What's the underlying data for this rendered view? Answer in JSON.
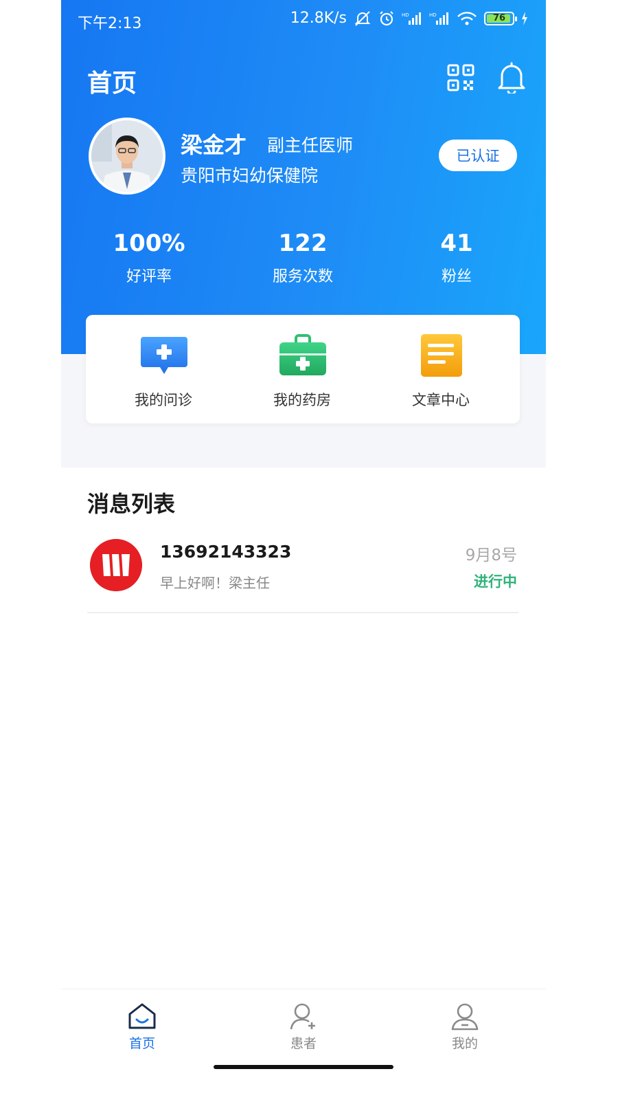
{
  "status_bar": {
    "time": "下午2:13",
    "net_speed": "12.8K/s",
    "battery_level": "76"
  },
  "header": {
    "title": "首页"
  },
  "profile": {
    "name": "梁金才",
    "title": "副主任医师",
    "hospital": "贵阳市妇幼保健院",
    "verified_label": "已认证"
  },
  "stats": [
    {
      "value": "100%",
      "label": "好评率"
    },
    {
      "value": "122",
      "label": "服务次数"
    },
    {
      "value": "41",
      "label": "粉丝"
    }
  ],
  "quick_actions": [
    {
      "label": "我的问诊",
      "icon": "consultation-icon",
      "color": "#2f86f1"
    },
    {
      "label": "我的药房",
      "icon": "medicine-kit-icon",
      "color": "#2fbf71"
    },
    {
      "label": "文章中心",
      "icon": "article-icon",
      "color": "#f6b31b"
    }
  ],
  "messages": {
    "heading": "消息列表",
    "items": [
      {
        "name": "13692143323",
        "preview": "早上好啊！梁主任",
        "date": "9月8号",
        "status": "进行中"
      }
    ]
  },
  "tabbar": {
    "items": [
      {
        "label": "首页",
        "icon": "home-icon",
        "active": true
      },
      {
        "label": "患者",
        "icon": "patient-icon",
        "active": false
      },
      {
        "label": "我的",
        "icon": "profile-icon",
        "active": false
      }
    ]
  },
  "colors": {
    "primary": "#1677f2",
    "accent_green": "#2fb27a",
    "brand_red": "#e51f23"
  }
}
